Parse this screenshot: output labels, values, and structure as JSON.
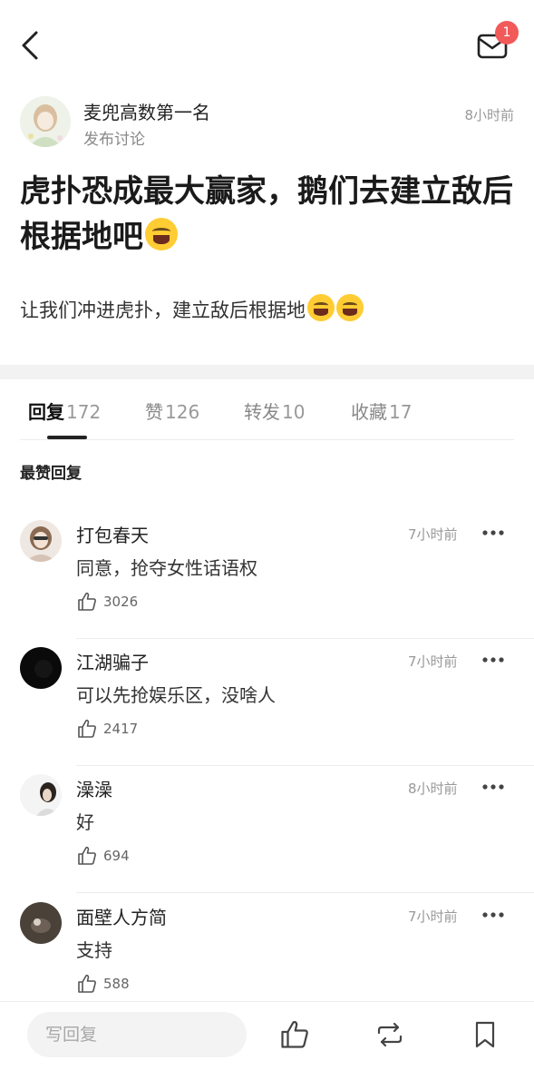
{
  "header": {
    "mail_badge_count": "1"
  },
  "post": {
    "author_name": "麦兜高数第一名",
    "author_subtitle": "发布讨论",
    "time": "8小时前",
    "title": "虎扑恐成最大赢家，鹅们去建立敌后根据地吧",
    "body": "让我们冲进虎扑，建立敌后根据地",
    "title_emoji": "tears-of-joy-emoji",
    "body_emoji": "tears-of-joy-emoji"
  },
  "tabs": [
    {
      "label": "回复",
      "count": "172",
      "active": true
    },
    {
      "label": "赞",
      "count": "126",
      "active": false
    },
    {
      "label": "转发",
      "count": "10",
      "active": false
    },
    {
      "label": "收藏",
      "count": "17",
      "active": false
    }
  ],
  "section_title": "最赞回复",
  "comments": [
    {
      "name": "打包春天",
      "time": "7小时前",
      "text": "同意，抢夺女性话语权",
      "likes": "3026"
    },
    {
      "name": "江湖骗子",
      "time": "7小时前",
      "text": "可以先抢娱乐区，没啥人",
      "likes": "2417"
    },
    {
      "name": "澡澡",
      "time": "8小时前",
      "text": "好",
      "likes": "694"
    },
    {
      "name": "面壁人方简",
      "time": "7小时前",
      "text": "支持",
      "likes": "588"
    }
  ],
  "bottom": {
    "reply_placeholder": "写回复"
  },
  "colors": {
    "badge": "#f25959",
    "emoji": "#ffcc33",
    "muted_text": "#999999"
  }
}
